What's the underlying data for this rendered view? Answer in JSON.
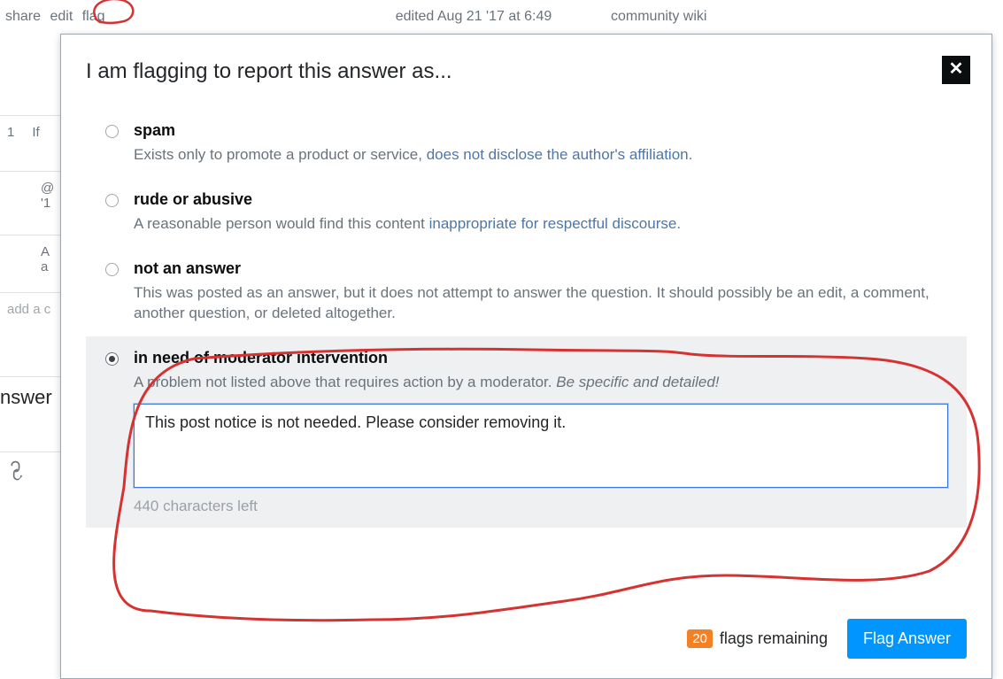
{
  "post_menu": {
    "share": "share",
    "edit": "edit",
    "flag": "flag"
  },
  "edited": {
    "label": "edited",
    "date": "Aug 21 '17 at 6:49"
  },
  "wiki": "community wiki",
  "strips": {
    "vote": "1",
    "if": "If",
    "at": "@",
    "apos": "'1",
    "a1": "A",
    "a2": "a",
    "addcomment": "add a c",
    "answer": "nswer"
  },
  "dialog": {
    "title": "I am flagging to report this answer as...",
    "options": {
      "spam": {
        "title": "spam",
        "desc_pre": "Exists only to promote a product or service, ",
        "desc_link": "does not disclose the author's affiliation",
        "desc_post": "."
      },
      "rude": {
        "title": "rude or abusive",
        "desc_pre": "A reasonable person would find this content ",
        "desc_link": "inappropriate for respectful discourse",
        "desc_post": "."
      },
      "naa": {
        "title": "not an answer",
        "desc": "This was posted as an answer, but it does not attempt to answer the question. It should possibly be an edit, a comment, another question, or deleted altogether."
      },
      "mod": {
        "title": "in need of moderator intervention",
        "desc_pre": "A problem not listed above that requires action by a moderator. ",
        "desc_em": "Be specific and detailed!",
        "textarea_value": "This post notice is not needed. Please consider removing it.",
        "char_count": "440 characters left"
      }
    },
    "footer": {
      "flags_count": "20",
      "flags_label": "flags remaining",
      "submit": "Flag Answer"
    }
  }
}
